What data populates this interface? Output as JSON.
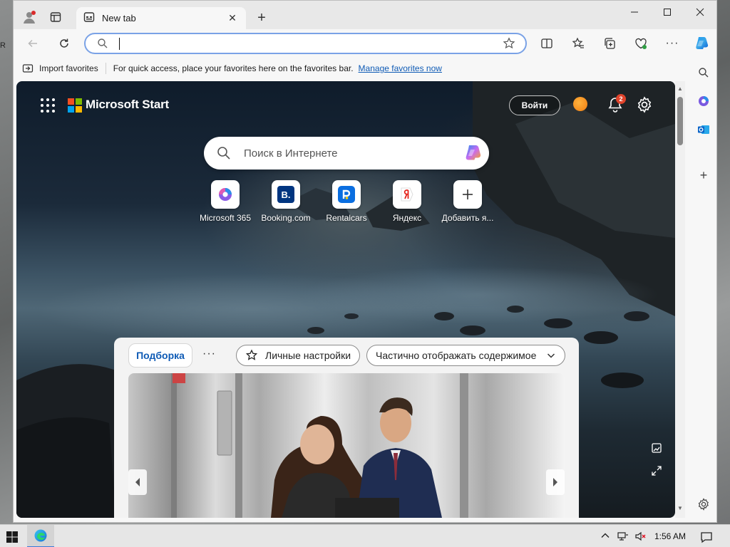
{
  "browser": {
    "tab_title": "New tab",
    "address_value": "",
    "favorites_bar": {
      "import_label": "Import favorites",
      "hint_text": "For quick access, place your favorites here on the favorites bar.",
      "manage_link": "Manage favorites now"
    }
  },
  "page": {
    "brand": "Microsoft Start",
    "signin_label": "Войти",
    "notification_count": "2",
    "search_placeholder": "Поиск в Интернете",
    "quick_links": [
      {
        "label": "Microsoft 365",
        "icon": "microsoft365-icon"
      },
      {
        "label": "Booking.com",
        "icon": "booking-icon"
      },
      {
        "label": "Rentalcars",
        "icon": "rentalcars-icon"
      },
      {
        "label": "Яндекс",
        "icon": "yandex-icon"
      },
      {
        "label": "Добавить я...",
        "icon": "plus-icon"
      }
    ],
    "feed": {
      "active_tab": "Подборка",
      "more_label": "···",
      "personalize_label": "Личные настройки",
      "content_mode_label": "Частично отображать содержимое"
    }
  },
  "taskbar": {
    "time": "1:56 AM"
  },
  "colors": {
    "accent": "#0f5bb5",
    "address_border": "#7aa2e6",
    "badge": "#e0432b"
  }
}
